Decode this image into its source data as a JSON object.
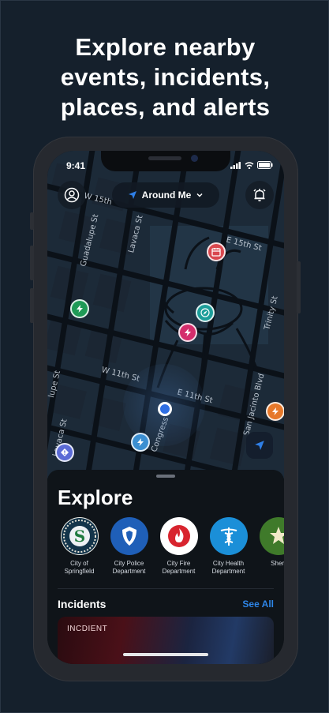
{
  "headline": {
    "line1": "Explore nearby",
    "line2": "events, incidents,",
    "line3": "places, and alerts"
  },
  "status_bar": {
    "time": "9:41"
  },
  "map": {
    "location_pill": "Around Me",
    "street_labels": {
      "w15th": "W 15th",
      "lavaca": "Lavaca St",
      "guadalupe": "Guadalupe St",
      "e15th": "E 15th St",
      "trinity": "Trinity St",
      "w11th": "W 11th St",
      "e11th": "E 11th St",
      "san_jacinto": "San Jacinto Blvd",
      "lavaca2": "Lavaca St",
      "lupe": "lupe St",
      "congress": "Congress"
    },
    "colors": {
      "marker_calendar": "#d9484f",
      "marker_green": "#1f9a56",
      "marker_teal": "#1d9e9a",
      "marker_pink": "#d42d6c",
      "marker_orange": "#e6782a",
      "marker_purple": "#5b6bd6",
      "marker_blue": "#3b8fd1"
    }
  },
  "explore": {
    "title": "Explore",
    "agencies": [
      {
        "line1": "City of",
        "line2": "Springfield",
        "icon": "seal-icon"
      },
      {
        "line1": "City Police",
        "line2": "Department",
        "icon": "police-badge-icon"
      },
      {
        "line1": "City Fire",
        "line2": "Department",
        "icon": "fire-icon"
      },
      {
        "line1": "City Health",
        "line2": "Department",
        "icon": "caduceus-icon"
      },
      {
        "line1": "Sheri",
        "line2": "",
        "icon": "sheriff-star-icon"
      }
    ],
    "seal_letter": "S"
  },
  "incidents": {
    "title": "Incidents",
    "see_all": "See All",
    "card_tag": "INCDIENT"
  }
}
